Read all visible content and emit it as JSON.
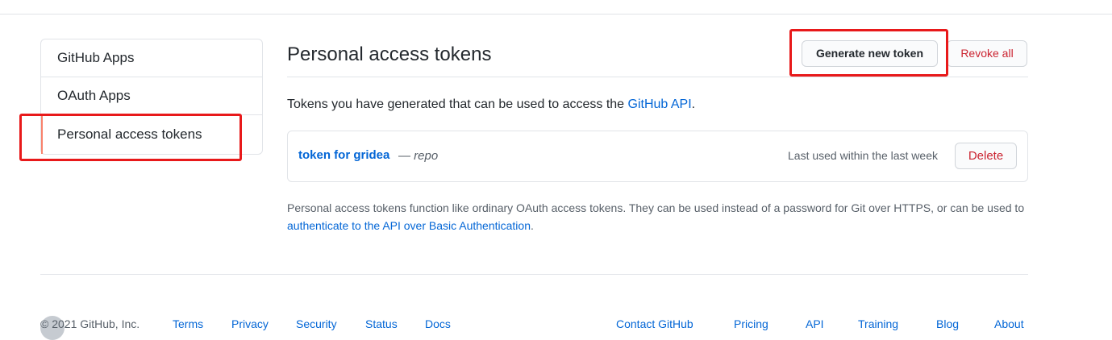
{
  "sidebar": {
    "items": [
      {
        "label": "GitHub Apps"
      },
      {
        "label": "OAuth Apps"
      },
      {
        "label": "Personal access tokens"
      }
    ]
  },
  "main": {
    "title": "Personal access tokens",
    "generate_label": "Generate new token",
    "revoke_label": "Revoke all",
    "description_prefix": "Tokens you have generated that can be used to access the ",
    "description_link": "GitHub API",
    "description_suffix": ".",
    "token": {
      "name": "token for gridea",
      "separator": " — ",
      "scope": "repo",
      "last_used": "Last used within the last week",
      "delete_label": "Delete"
    },
    "note_prefix": "Personal access tokens function like ordinary OAuth access tokens. They can be used instead of a password for Git over HTTPS, or can be used to ",
    "note_link": "authenticate to the API over Basic Authentication",
    "note_suffix": "."
  },
  "footer": {
    "copyright": "© 2021 GitHub, Inc.",
    "left_links": [
      "Terms",
      "Privacy",
      "Security",
      "Status",
      "Docs"
    ],
    "right_links": [
      "Contact GitHub",
      "Pricing",
      "API",
      "Training",
      "Blog",
      "About"
    ]
  },
  "colors": {
    "link": "#0366d6",
    "danger": "#cb2431",
    "annotation": "#e8191a",
    "selected_marker": "#f9826c"
  }
}
